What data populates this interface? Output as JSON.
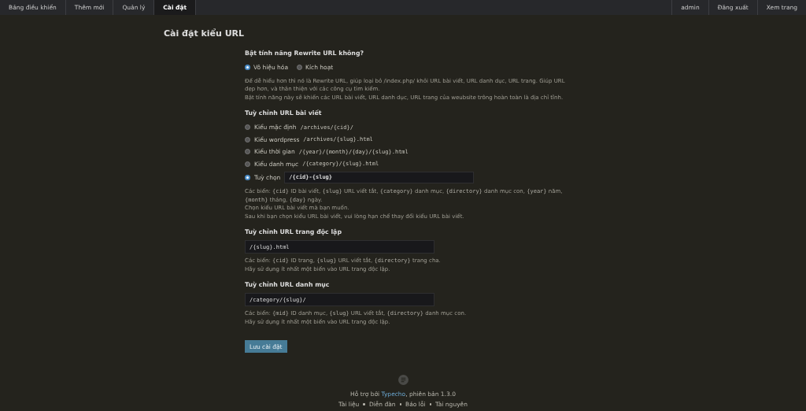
{
  "nav_left": [
    {
      "label": "Bảng điều khiển",
      "selected": false
    },
    {
      "label": "Thêm mới",
      "selected": false
    },
    {
      "label": "Quản lý",
      "selected": false
    },
    {
      "label": "Cài đặt",
      "selected": true
    }
  ],
  "nav_right": [
    {
      "label": "admin"
    },
    {
      "label": "Đăng xuất"
    },
    {
      "label": "Xem trang"
    }
  ],
  "page_title": "Cài đặt kiểu URL",
  "rewrite": {
    "label": "Bật tính năng Rewrite URL không?",
    "options": [
      {
        "label": "Vô hiệu hóa",
        "selected": true
      },
      {
        "label": "Kích hoạt",
        "selected": false
      }
    ],
    "help": [
      [
        {
          "kind": "plain",
          "text": "Để dễ hiểu hơn thì nó là Rewrite URL, giúp loại bỏ /index.php/ khỏi URL bài viết, URL danh dục, URL trang. Giúp URL đẹp hơn, và thân thiện với các công cụ tìm kiếm."
        }
      ],
      [
        {
          "kind": "plain",
          "text": "Bật tính năng này sẽ khiến các URL bài viết, URL danh dục, URL trang của weubsite trông hoàn toàn là địa chỉ tĩnh."
        }
      ]
    ]
  },
  "post_url": {
    "label": "Tuỳ chỉnh URL bài viết",
    "options": [
      {
        "kind": "preset",
        "label": "Kiểu mặc định",
        "pattern": "/archives/{cid}/",
        "selected": false
      },
      {
        "kind": "preset",
        "label": "Kiểu wordpress",
        "pattern": "/archives/{slug}.html",
        "selected": false
      },
      {
        "kind": "preset",
        "label": "Kiểu thời gian",
        "pattern": "/{year}/{month}/{day}/{slug}.html",
        "selected": false
      },
      {
        "kind": "preset",
        "label": "Kiểu danh mục",
        "pattern": "/{category}/{slug}.html",
        "selected": false
      },
      {
        "kind": "custom",
        "label": "Tuỳ chọn",
        "value": "/{cid}-{slug}",
        "selected": true
      }
    ],
    "help": [
      [
        {
          "kind": "plain",
          "text": "Các biến: "
        },
        {
          "kind": "code",
          "text": "{cid}"
        },
        {
          "kind": "plain",
          "text": " ID bài viết, "
        },
        {
          "kind": "code",
          "text": "{slug}"
        },
        {
          "kind": "plain",
          "text": " URL viết tắt, "
        },
        {
          "kind": "code",
          "text": "{category}"
        },
        {
          "kind": "plain",
          "text": " danh mục, "
        },
        {
          "kind": "code",
          "text": "{directory}"
        },
        {
          "kind": "plain",
          "text": " danh mục con, "
        },
        {
          "kind": "code",
          "text": "{year}"
        },
        {
          "kind": "plain",
          "text": " năm, "
        },
        {
          "kind": "code",
          "text": "{month}"
        },
        {
          "kind": "plain",
          "text": " tháng, "
        },
        {
          "kind": "code",
          "text": "{day}"
        },
        {
          "kind": "plain",
          "text": " ngày."
        }
      ],
      [
        {
          "kind": "plain",
          "text": "Chọn kiểu URL bài viết mà bạn muốn."
        }
      ],
      [
        {
          "kind": "plain",
          "text": "Sau khi bạn chọn kiểu URL bài viết, vui lòng hạn chế thay đổi kiểu URL bài viết."
        }
      ]
    ]
  },
  "page_url": {
    "label": "Tuỳ chỉnh URL trang độc lập",
    "value": "/{slug}.html",
    "help": [
      [
        {
          "kind": "plain",
          "text": "Các biến: "
        },
        {
          "kind": "code",
          "text": "{cid}"
        },
        {
          "kind": "plain",
          "text": " ID trang, "
        },
        {
          "kind": "code",
          "text": "{slug}"
        },
        {
          "kind": "plain",
          "text": " URL viết tắt, "
        },
        {
          "kind": "code",
          "text": "{directory}"
        },
        {
          "kind": "plain",
          "text": " trang cha."
        }
      ],
      [
        {
          "kind": "plain",
          "text": "Hãy sử dụng ít nhất một biến vào URL trang độc lập."
        }
      ]
    ]
  },
  "category_url": {
    "label": "Tuỳ chỉnh URL danh mục",
    "value": "/category/{slug}/",
    "help": [
      [
        {
          "kind": "plain",
          "text": "Các biến: "
        },
        {
          "kind": "code",
          "text": "{mid}"
        },
        {
          "kind": "plain",
          "text": " ID danh mục, "
        },
        {
          "kind": "code",
          "text": "{slug}"
        },
        {
          "kind": "plain",
          "text": " URL viết tắt, "
        },
        {
          "kind": "code",
          "text": "{directory}"
        },
        {
          "kind": "plain",
          "text": " danh mục con."
        }
      ],
      [
        {
          "kind": "plain",
          "text": "Hãy sử dụng ít nhất một biến vào URL trang độc lập."
        }
      ]
    ]
  },
  "save_button": "Lưu cài đặt",
  "footer": {
    "powered_prefix": "Hỗ trợ bởi ",
    "powered_link": "Typecho",
    "powered_suffix": ", phiên bản 1.3.0",
    "links": [
      "Tài liệu",
      "Diễn đàn",
      "Báo lỗi",
      "Tài nguyên"
    ]
  }
}
